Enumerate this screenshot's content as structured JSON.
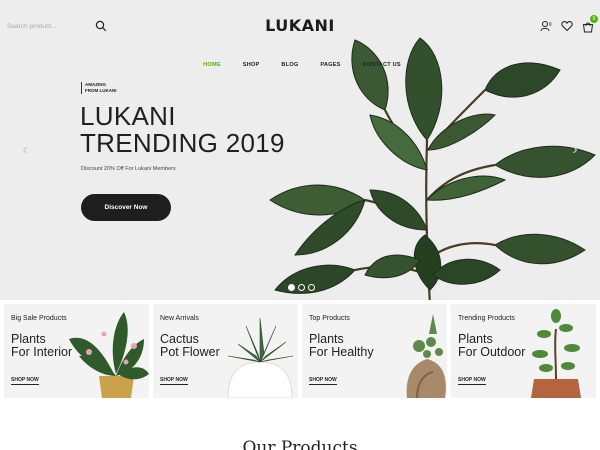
{
  "header": {
    "search_placeholder": "Search product...",
    "logo": "LUKANI",
    "cart_count": "0",
    "icons": [
      "search-icon",
      "user-icon",
      "heart-icon",
      "cart-icon"
    ]
  },
  "nav": [
    {
      "label": "HOME",
      "active": true
    },
    {
      "label": "SHOP",
      "active": false
    },
    {
      "label": "BLOG",
      "active": false
    },
    {
      "label": "PAGES",
      "active": false
    },
    {
      "label": "CONTACT US",
      "active": false
    }
  ],
  "hero": {
    "kicker_line1": "AMAZING",
    "kicker_line2": "FROM LUKANI",
    "title_line1": "LUKANI",
    "title_line2": "TRENDING 2019",
    "subtitle": "Discount 20% Off For Lukani Members",
    "cta": "Discover Now",
    "arrows": [
      "chevron-left-icon",
      "chevron-right-icon"
    ],
    "slides": 3,
    "active_slide": 1
  },
  "banners": [
    {
      "category": "Big Sale Products",
      "line1": "Plants",
      "line2": "For Interior",
      "cta": "SHOP NOW"
    },
    {
      "category": "New Arrivals",
      "line1": "Cactus",
      "line2": "Pot Flower",
      "cta": "SHOP NOW"
    },
    {
      "category": "Top Products",
      "line1": "Plants",
      "line2": "For Healthy",
      "cta": "SHOP NOW"
    },
    {
      "category": "Trending Products",
      "line1": "Plants",
      "line2": "For Outdoor",
      "cta": "SHOP NOW"
    }
  ],
  "section_title": "Our Products",
  "colors": {
    "accent": "#56b10c",
    "hero_bg": "#ededed",
    "button_dark": "#1e1e1e",
    "banner_bg": "#f3f3f3"
  }
}
